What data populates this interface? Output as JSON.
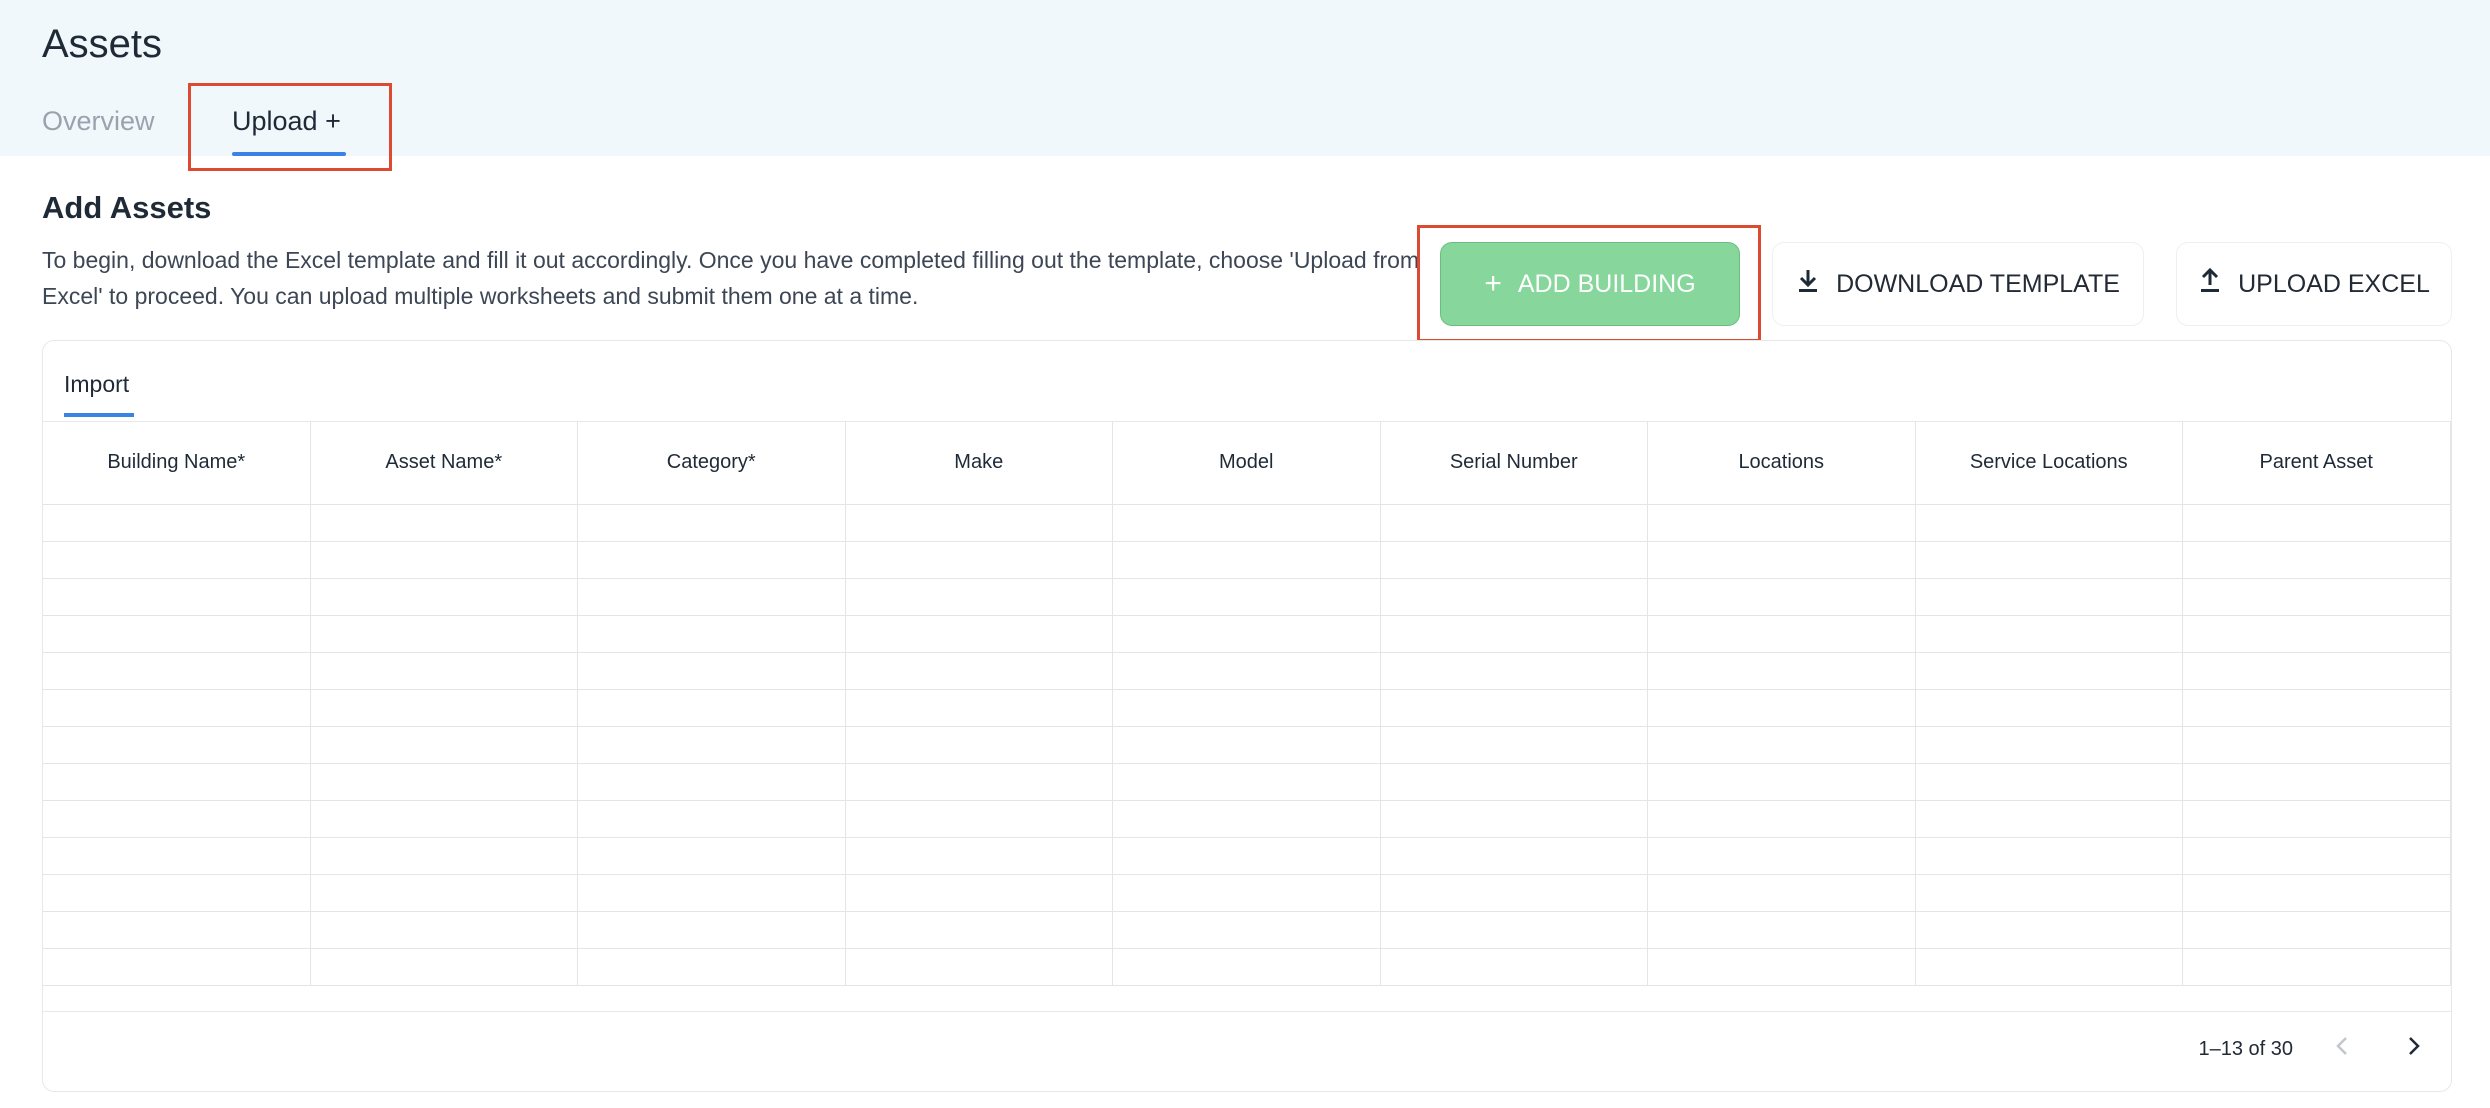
{
  "header": {
    "title": "Assets",
    "tabs": [
      {
        "label": "Overview",
        "active": false
      },
      {
        "label": "Upload +",
        "active": true
      }
    ]
  },
  "section": {
    "title": "Add Assets",
    "description": "To begin, download the Excel template and fill it out accordingly. Once you have completed filling out the template, choose 'Upload from Excel' to proceed. You can upload multiple worksheets and submit them one at a time."
  },
  "actions": {
    "add_building": "ADD BUILDING",
    "download_template": "DOWNLOAD TEMPLATE",
    "upload_excel": "UPLOAD EXCEL"
  },
  "import_card": {
    "tab_label": "Import",
    "columns": [
      "Building Name*",
      "Asset Name*",
      "Category*",
      "Make",
      "Model",
      "Serial Number",
      "Locations",
      "Service Locations",
      "Parent Asset"
    ],
    "row_count": 13,
    "pagination": "1–13 of 30"
  },
  "colors": {
    "accent": "#3b82e6",
    "add_button": "#87d79c",
    "highlight": "#dc4a32",
    "header_bg": "#f1f8fc"
  },
  "icons": {
    "add": "plus-icon",
    "download": "download-icon",
    "upload": "upload-icon",
    "prev": "chevron-left-icon",
    "next": "chevron-right-icon"
  }
}
